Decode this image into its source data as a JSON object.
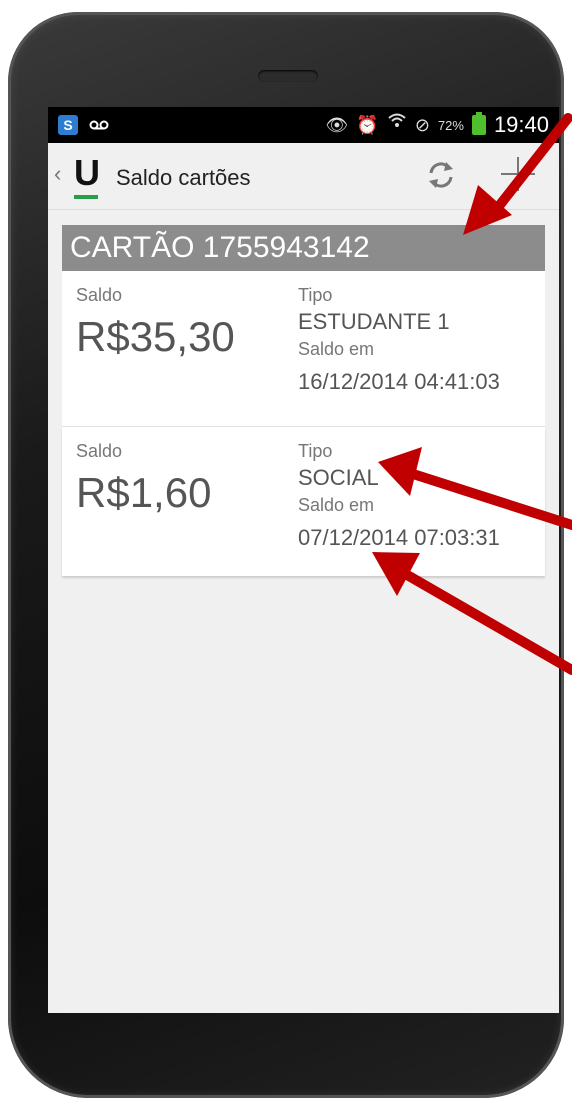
{
  "status_bar": {
    "left_icons": [
      "s-icon",
      "voicemail-icon"
    ],
    "battery_percent": "72%",
    "time": "19:40"
  },
  "action_bar": {
    "back_glyph": "‹",
    "logo_letter": "U",
    "title": "Saldo cartões"
  },
  "card": {
    "header": "CARTÃO 1755943142",
    "entries": [
      {
        "saldo_label": "Saldo",
        "saldo_value": "R$35,30",
        "tipo_label": "Tipo",
        "tipo_value": "ESTUDANTE 1",
        "saldo_em_label": "Saldo em",
        "saldo_em_value": "16/12/2014 04:41:03"
      },
      {
        "saldo_label": "Saldo",
        "saldo_value": "R$1,60",
        "tipo_label": "Tipo",
        "tipo_value": "SOCIAL",
        "saldo_em_label": "Saldo em",
        "saldo_em_value": "07/12/2014 07:03:31"
      }
    ]
  },
  "colors": {
    "header_bg": "#8c8c8c",
    "logo_bar": "#2a9d4b",
    "arrow": "#c00000",
    "battery": "#4fbf2f"
  }
}
